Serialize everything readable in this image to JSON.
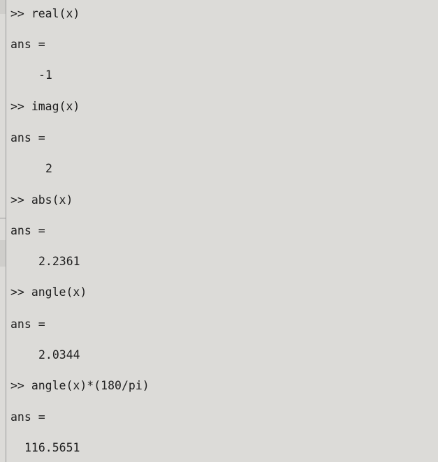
{
  "console": {
    "prompt": ">>",
    "entries": [
      {
        "command": "real(x)",
        "ans_label": "ans =",
        "result": "-1"
      },
      {
        "command": "imag(x)",
        "ans_label": "ans =",
        "result": "2"
      },
      {
        "command": "abs(x)",
        "ans_label": "ans =",
        "result": "2.2361"
      },
      {
        "command": "angle(x)",
        "ans_label": "ans =",
        "result": "2.0344"
      },
      {
        "command": "angle(x)*(180/pi)",
        "ans_label": "ans =",
        "result": "116.5651"
      }
    ]
  }
}
